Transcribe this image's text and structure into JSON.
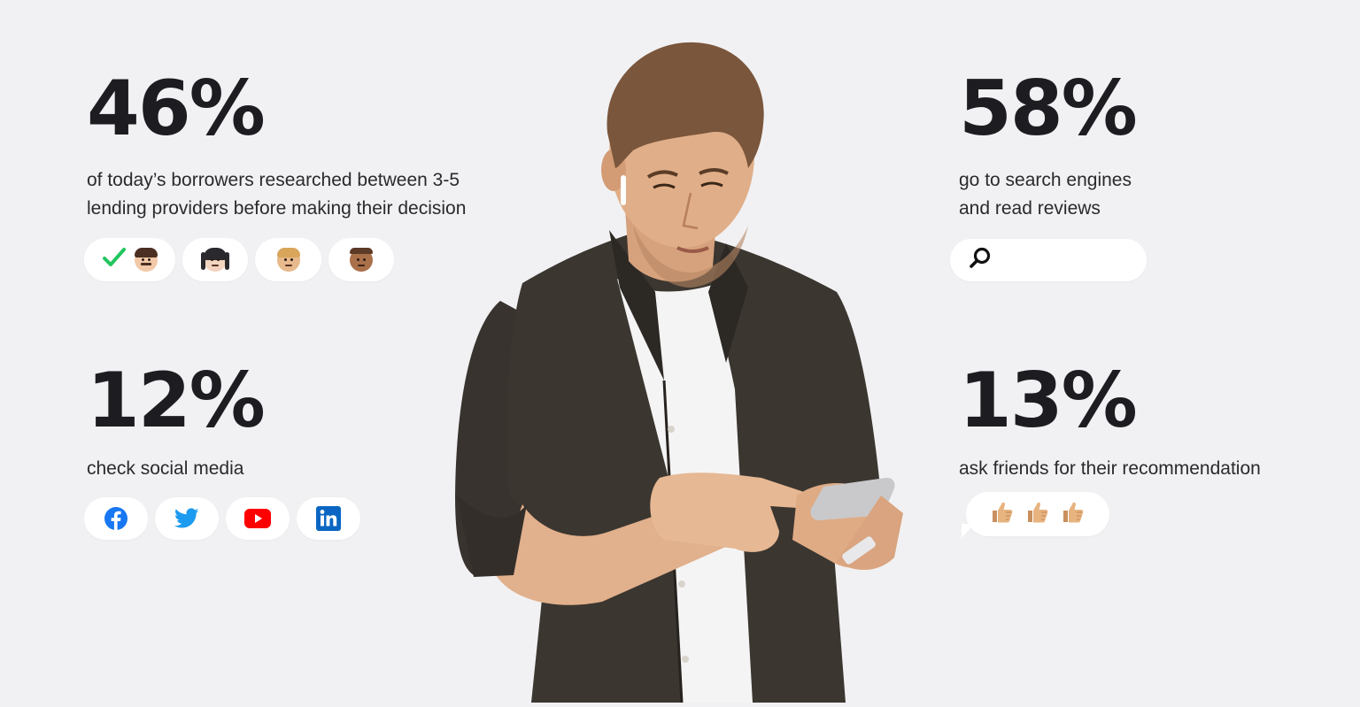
{
  "stats": {
    "borrowers": {
      "value": "46%",
      "desc_line1": "of today’s borrowers researched between 3-5",
      "desc_line2": "lending providers before making their decision"
    },
    "search": {
      "value": "58%",
      "desc_line1": "go to search engines",
      "desc_line2": "and read reviews"
    },
    "social": {
      "value": "12%",
      "desc_line1": "check social media"
    },
    "friends": {
      "value": "13%",
      "desc_line1": "ask friends for their recommendation"
    }
  },
  "icons": {
    "check": "check-icon",
    "faces": [
      "man-mustache-face-icon",
      "woman-face-icon",
      "blond-man-face-icon",
      "bald-man-face-icon"
    ],
    "search": "magnifier-icon",
    "social": [
      "facebook-icon",
      "twitter-icon",
      "youtube-icon",
      "linkedin-icon"
    ],
    "thumbs": [
      "thumbs-up-icon",
      "thumbs-up-icon",
      "thumbs-up-icon"
    ]
  },
  "colors": {
    "background": "#f1f1f3",
    "check": "#22c55e",
    "facebook": "#1877f2",
    "twitter": "#1d9bf0",
    "youtube": "#ff0000",
    "linkedin": "#0a66c2",
    "shirt": "#3b3630",
    "tshirt": "#f7f7f7"
  }
}
